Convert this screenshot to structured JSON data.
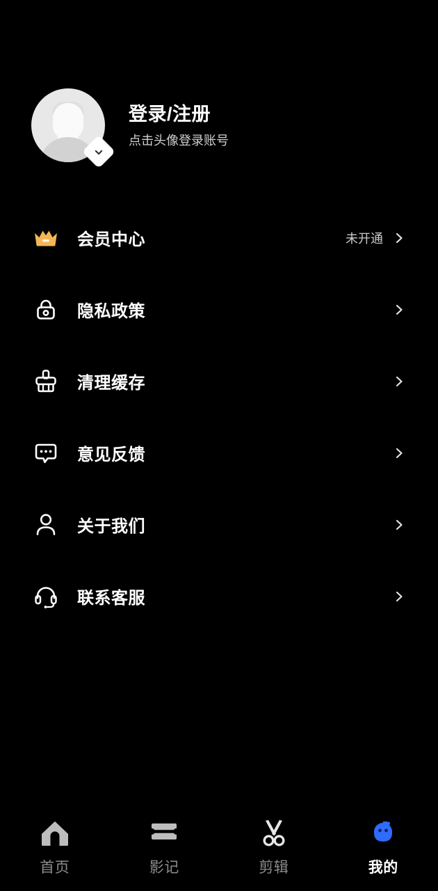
{
  "theme": {
    "background": "#000000",
    "text_primary": "#ffffff",
    "text_secondary": "#cfcfcf",
    "accent_blue": "#2f6bff",
    "crown_gold": "#f5b555",
    "tab_inactive": "#8d8d8d"
  },
  "profile": {
    "title": "登录/注册",
    "subtitle": "点击头像登录账号",
    "avatar_icon": "default-user-avatar",
    "badge_icon": "chevron-down-badge-icon"
  },
  "menu": {
    "items": [
      {
        "id": "member-center",
        "label": "会员中心",
        "icon": "crown-icon",
        "value": "未开通"
      },
      {
        "id": "privacy-policy",
        "label": "隐私政策",
        "icon": "lock-icon",
        "value": ""
      },
      {
        "id": "clear-cache",
        "label": "清理缓存",
        "icon": "broom-icon",
        "value": ""
      },
      {
        "id": "feedback",
        "label": "意见反馈",
        "icon": "chat-bubble-icon",
        "value": ""
      },
      {
        "id": "about-us",
        "label": "关于我们",
        "icon": "person-icon",
        "value": ""
      },
      {
        "id": "contact-support",
        "label": "联系客服",
        "icon": "headset-icon",
        "value": ""
      }
    ]
  },
  "tabbar": {
    "items": [
      {
        "id": "home",
        "label": "首页",
        "icon": "home-icon",
        "active": false
      },
      {
        "id": "moments",
        "label": "影记",
        "icon": "ticket-icon",
        "active": false
      },
      {
        "id": "edit",
        "label": "剪辑",
        "icon": "scissors-icon",
        "active": false
      },
      {
        "id": "mine",
        "label": "我的",
        "icon": "face-icon",
        "active": true
      }
    ]
  }
}
